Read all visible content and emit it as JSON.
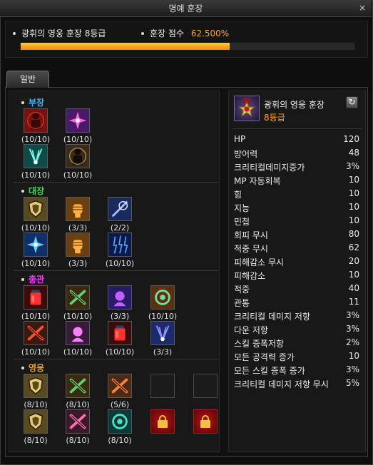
{
  "window": {
    "title": "명예 훈장",
    "close_label": "×"
  },
  "header": {
    "medal_label": "광휘의 영웅 훈장 8등급",
    "score_label": "훈장 점수",
    "score_value": "62.500%",
    "progress": 0.625
  },
  "tabs": [
    {
      "label": "일반",
      "active": true
    }
  ],
  "sections": [
    {
      "title": "부장",
      "color": "#3fb4ff",
      "slots": [
        {
          "icon": "red-warrior-icon",
          "level": "(10/10)"
        },
        {
          "icon": "pink-burst-icon",
          "level": "(10/10)"
        },
        {
          "icon": "teal-wings-icon",
          "level": "(10/10)"
        },
        {
          "icon": "dark-silhouette-icon",
          "level": "(10/10)"
        }
      ]
    },
    {
      "title": "대장",
      "color": "#3ddc4a",
      "slots": [
        {
          "icon": "gold-shield-icon",
          "level": "(10/10)"
        },
        {
          "icon": "gold-fist-icon",
          "level": "(3/3)"
        },
        {
          "icon": "blue-blade-icon",
          "level": "(2/2)"
        },
        {
          "icon": "blue-star-icon",
          "level": "(10/10)"
        },
        {
          "icon": "gold-fist-icon",
          "level": "(3/3)"
        },
        {
          "icon": "blue-lightning-icon",
          "level": "(10/10)"
        }
      ]
    },
    {
      "title": "총관",
      "color": "#ff3aff",
      "slots": [
        {
          "icon": "red-potion-icon",
          "level": "(10/10)"
        },
        {
          "icon": "green-cross-icon",
          "level": "(10/10)"
        },
        {
          "icon": "purple-beast-icon",
          "level": "(3/3)"
        },
        {
          "icon": "green-swirl-icon",
          "level": "(10/10)"
        },
        {
          "icon": "red-cross-icon",
          "level": "(10/10)"
        },
        {
          "icon": "pink-slash-icon",
          "level": "(10/10)"
        },
        {
          "icon": "red-potion-icon",
          "level": "(10/10)"
        },
        {
          "icon": "blue-wings-icon",
          "level": "(3/3)"
        }
      ]
    },
    {
      "title": "영웅",
      "color": "#ffa41c",
      "slots": [
        {
          "icon": "gold-shield-icon",
          "level": "(8/10)"
        },
        {
          "icon": "green-cross-icon",
          "level": "(8/10)"
        },
        {
          "icon": "orange-cross-icon",
          "level": "(5/6)"
        },
        {
          "icon": "empty",
          "level": ""
        },
        {
          "icon": "empty",
          "level": ""
        },
        {
          "icon": "gold-shield-icon",
          "level": "(8/10)"
        },
        {
          "icon": "pink-cross-icon",
          "level": "(8/10)"
        },
        {
          "icon": "teal-orb-icon",
          "level": "(8/10)"
        },
        {
          "icon": "lock-icon",
          "level": ""
        },
        {
          "icon": "lock-icon",
          "level": ""
        }
      ]
    }
  ],
  "detail": {
    "name": "광휘의 영웅 훈장",
    "grade": "8등급",
    "refresh_icon": "refresh-icon",
    "stats": [
      {
        "label": "HP",
        "value": "120"
      },
      {
        "label": "방어력",
        "value": "48"
      },
      {
        "label": "크리티컬데미지증가",
        "value": "3%"
      },
      {
        "label": "MP 자동회복",
        "value": "10"
      },
      {
        "label": "힘",
        "value": "10"
      },
      {
        "label": "지능",
        "value": "10"
      },
      {
        "label": "민첩",
        "value": "10"
      },
      {
        "label": "회피 무시",
        "value": "80"
      },
      {
        "label": "적중 무시",
        "value": "62"
      },
      {
        "label": "피해감소 무시",
        "value": "20"
      },
      {
        "label": "피해감소",
        "value": "10"
      },
      {
        "label": "적중",
        "value": "40"
      },
      {
        "label": "관통",
        "value": "11"
      },
      {
        "label": "크리티컬 데미지 저항",
        "value": "3%"
      },
      {
        "label": "다운 저항",
        "value": "3%"
      },
      {
        "label": "스킬 증폭저항",
        "value": "2%"
      },
      {
        "label": "모든 공격력 증가",
        "value": "10"
      },
      {
        "label": "모든 스킬 증폭 증가",
        "value": "3%"
      },
      {
        "label": "크리티컬 데미지 저항 무시",
        "value": "5%"
      }
    ]
  }
}
